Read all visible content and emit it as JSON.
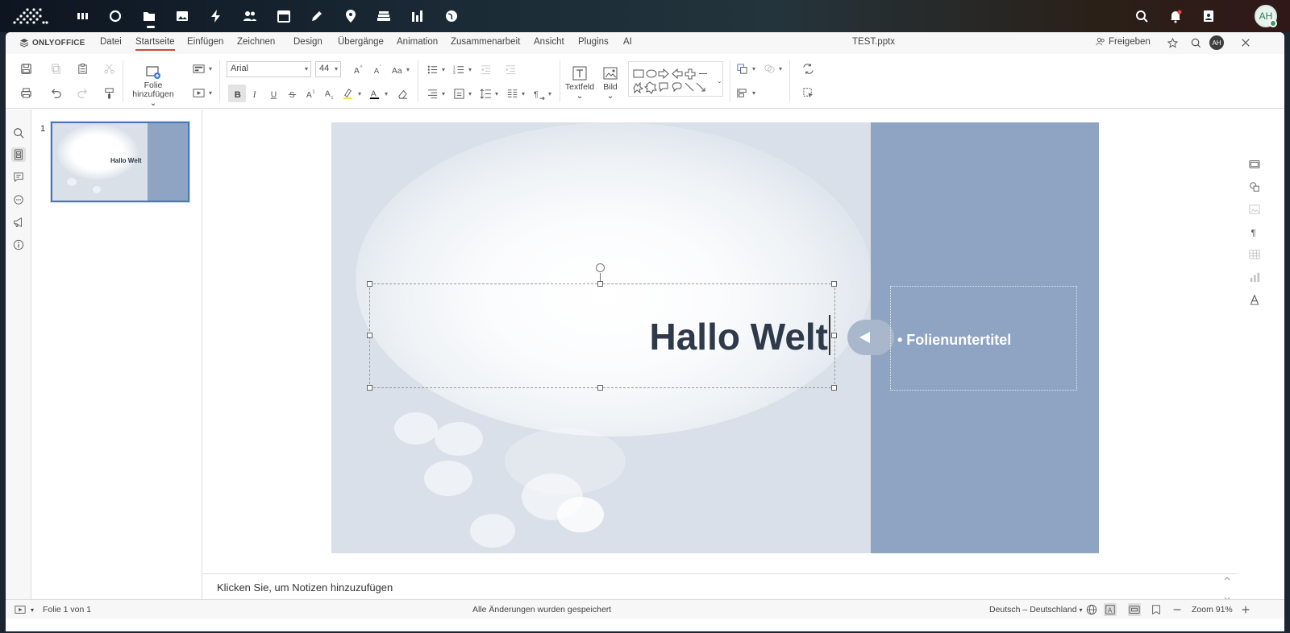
{
  "topbar": {
    "apps": [
      "dashboard-icon",
      "search-app-icon",
      "files-icon",
      "photos-icon",
      "activity-icon",
      "contacts-icon",
      "calendar-icon",
      "notes-icon",
      "maps-icon",
      "deck-icon",
      "analytics-icon",
      "globe-icon"
    ],
    "user_initials": "AH"
  },
  "menubar": {
    "brand": "ONLYOFFICE",
    "tabs": [
      "Datei",
      "Startseite",
      "Einfügen",
      "Zeichnen",
      "Design",
      "Übergänge",
      "Animation",
      "Zusammenarbeit",
      "Ansicht",
      "Plugins",
      "AI"
    ],
    "active_tab": "Startseite",
    "doc_title": "TEST.pptx",
    "share_label": "Freigeben",
    "user_initials": "AH"
  },
  "toolbar": {
    "add_slide_label_1": "Folie",
    "add_slide_label_2": "hinzufügen",
    "font_name": "Arial",
    "font_size": "44",
    "textbox_label": "Textfeld",
    "image_label": "Bild"
  },
  "slides_panel": {
    "thumb_number": "1",
    "thumb_title": "Hallo Welt"
  },
  "slide": {
    "title": "Hallo Welt",
    "subtitle": "• Folienuntertitel",
    "band_color": "#8fa4c3",
    "bg_color": "#d9e0e9"
  },
  "notes": {
    "placeholder": "Klicken Sie, um Notizen hinzuzufügen"
  },
  "statusbar": {
    "slide_info": "Folie 1 von 1",
    "save_status": "Alle Änderungen wurden gespeichert",
    "language": "Deutsch – Deutschland",
    "zoom": "Zoom 91%"
  }
}
